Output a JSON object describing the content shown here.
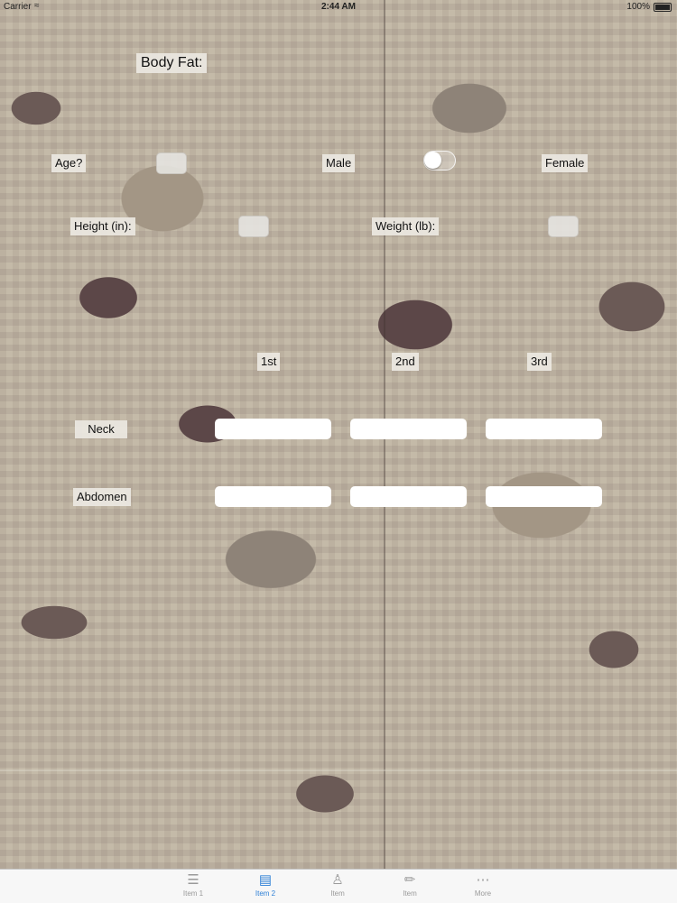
{
  "status": {
    "carrier": "Carrier",
    "time": "2:44 AM",
    "battery": "100%"
  },
  "form": {
    "title": "Body Fat:",
    "age_label": "Age?",
    "male_label": "Male",
    "female_label": "Female",
    "height_label": "Height (in):",
    "weight_label": "Weight (lb):",
    "col1": "1st",
    "col2": "2nd",
    "col3": "3rd",
    "neck_label": "Neck",
    "abdomen_label": "Abdomen",
    "gender_toggle_on": false
  },
  "tabs": [
    {
      "label": "Item 1",
      "icon": "list-icon"
    },
    {
      "label": "Item 2",
      "icon": "stack-icon"
    },
    {
      "label": "Item",
      "icon": "person-icon"
    },
    {
      "label": "Item",
      "icon": "figure-icon"
    },
    {
      "label": "More",
      "icon": "more-icon"
    }
  ],
  "colors": {
    "tab_active": "#2f80d6",
    "tab_inactive": "#9a9a9a"
  }
}
